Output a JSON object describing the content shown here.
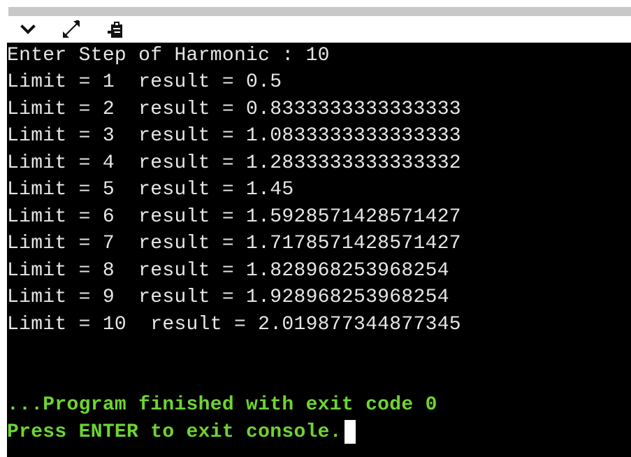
{
  "toolbar": {
    "icons": [
      "chevron-down-icon",
      "expand-icon",
      "clipboard-icon"
    ]
  },
  "console": {
    "prompt_line": "Enter Step of Harmonic : 10",
    "results": [
      "Limit = 1  result = 0.5",
      "Limit = 2  result = 0.8333333333333333",
      "Limit = 3  result = 1.0833333333333333",
      "Limit = 4  result = 1.2833333333333332",
      "Limit = 5  result = 1.45",
      "Limit = 6  result = 1.5928571428571427",
      "Limit = 7  result = 1.7178571428571427",
      "Limit = 8  result = 1.828968253968254",
      "Limit = 9  result = 1.928968253968254",
      "Limit = 10  result = 2.019877344877345"
    ],
    "finished_message": "...Program finished with exit code 0",
    "exit_prompt": "Press ENTER to exit console."
  },
  "colors": {
    "console_bg": "#000000",
    "console_text": "#e6e6e6",
    "status_text": "#6ed432"
  }
}
